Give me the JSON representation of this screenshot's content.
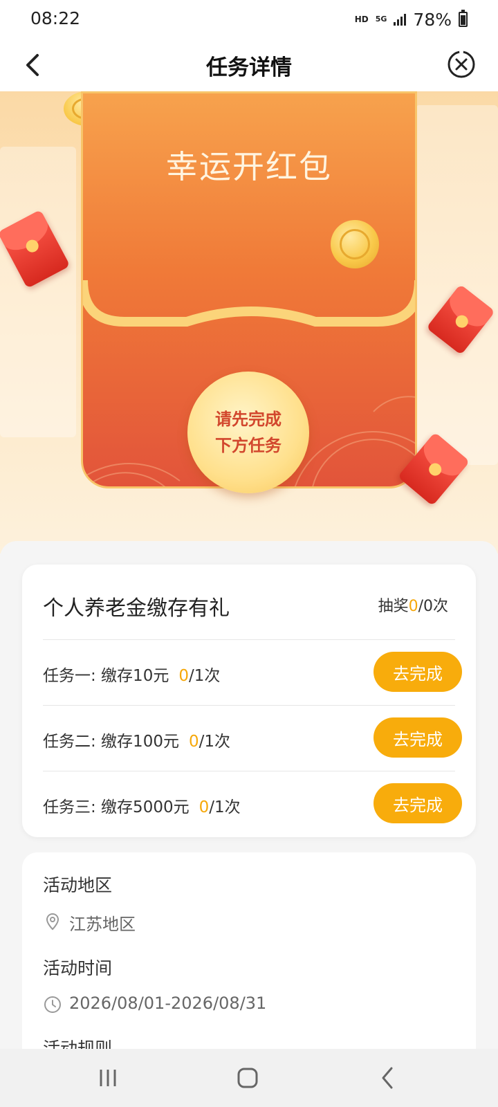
{
  "status": {
    "time": "08:22",
    "network_hd": "HD",
    "network_5g": "5G",
    "battery": "78%"
  },
  "header": {
    "title": "任务详情",
    "back_icon": "chevron-left-icon",
    "close_icon": "close-circle-icon"
  },
  "hero": {
    "envelope_title": "幸运开红包",
    "seal_line1": "请先完成",
    "seal_line2": "下方任务"
  },
  "task_card": {
    "title": "个人养老金缴存有礼",
    "draw_prefix": "抽奖",
    "draw_used": "0",
    "draw_suffix": "/0次",
    "tasks": [
      {
        "label": "任务一: 缴存10元",
        "done": "0",
        "total": "/1次",
        "button": "去完成"
      },
      {
        "label": "任务二: 缴存100元",
        "done": "0",
        "total": "/1次",
        "button": "去完成"
      },
      {
        "label": "任务三: 缴存5000元",
        "done": "0",
        "total": "/1次",
        "button": "去完成"
      }
    ]
  },
  "info": {
    "region_label": "活动地区",
    "region_value": "江苏地区",
    "time_label": "活动时间",
    "time_value": "2026/08/01-2026/08/31",
    "rules_label": "活动规则"
  },
  "colors": {
    "accent": "#f8ac0c",
    "highlight": "#f6a80a",
    "envelope_red": "#e2543a"
  }
}
